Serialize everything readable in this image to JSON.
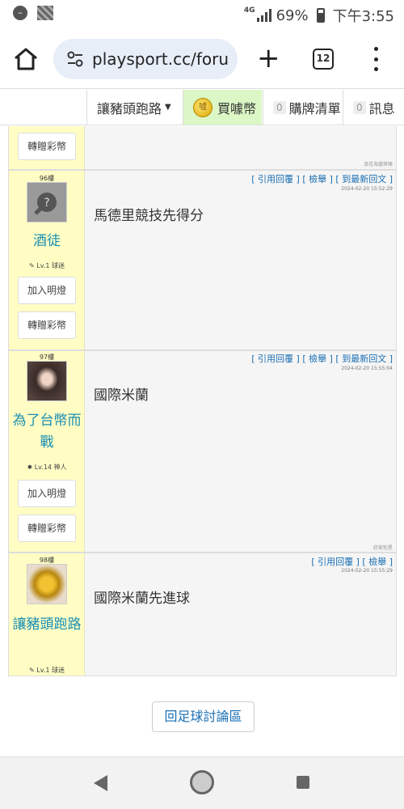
{
  "status_bar": {
    "network": "4G",
    "battery": "69%",
    "time": "下午3:55"
  },
  "browser": {
    "url": "playsport.cc/foru",
    "tab_count": "12"
  },
  "site_nav": {
    "user": "讓豬頭跑路",
    "buy_coins": "買噱幣",
    "coin_glyph": "噓",
    "cart_count": "0",
    "cart": "購牌清單",
    "msg_count": "0",
    "messages": "訊息"
  },
  "top_partial": {
    "gift_button": "轉贈彩幣",
    "signature": "浪花海盧蒋嘛"
  },
  "posts": [
    {
      "floor": "96樓",
      "username": "酒徒",
      "level": "✎ Lv.1 球迷",
      "follow_button": "加入明燈",
      "gift_button": "轉贈彩幣",
      "actions": "[ 引用回覆 ]  [ 檢舉 ]  [ 到最新回文 ]",
      "time": "2024-02-20 15:52:29",
      "content": "馬德里競技先得分",
      "signature": ""
    },
    {
      "floor": "97樓",
      "username": "為了台幣而戰",
      "level": "✸ Lv.14 神人",
      "follow_button": "加入明燈",
      "gift_button": "轉贈彩幣",
      "actions": "[ 引用回覆 ]  [ 檢舉 ]  [ 到最新回文 ]",
      "time": "2024-02-20 15:55:04",
      "content": "國際米蘭",
      "signature": "莊家剋星"
    },
    {
      "floor": "98樓",
      "username": "讓豬頭跑路",
      "level": "✎ Lv.1 球迷",
      "actions": "[ 引用回覆 ]  [ 檢舉 ]",
      "time": "2024-02-20 15:55:29",
      "content": "國際米蘭先進球"
    }
  ],
  "back_button": "回足球討論區",
  "colors": {
    "link": "#1a6fb3",
    "username": "#1a8fb3",
    "sidebar": "#fffdc4",
    "buy_bg": "#dcf7c5"
  }
}
